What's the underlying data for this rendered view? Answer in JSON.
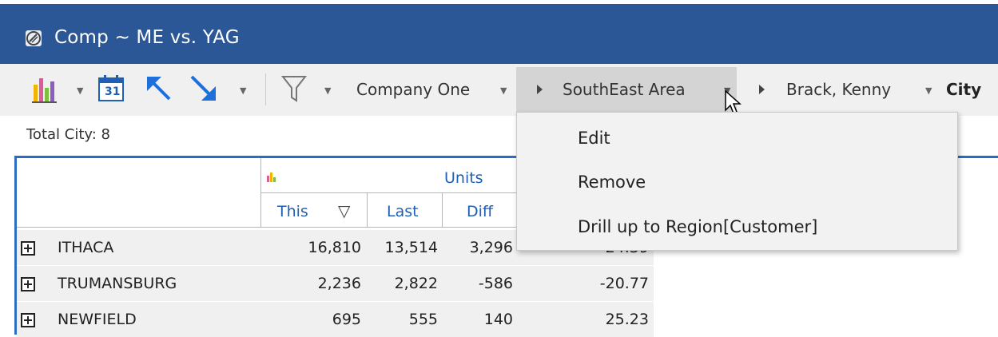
{
  "window": {
    "title": "Comp ~ ME vs. YAG"
  },
  "toolbar": {
    "calendar_day": "31",
    "breadcrumbs": [
      {
        "label": "Company One"
      },
      {
        "label": "SouthEast Area"
      },
      {
        "label": "Brack, Kenny"
      }
    ],
    "level_label": "City"
  },
  "summary": {
    "total": "Total City: 8"
  },
  "grid": {
    "group_header": "Units",
    "columns": [
      "This",
      "Last",
      "Diff"
    ],
    "sort_indicator": "▽",
    "rows": [
      {
        "name": "ITHACA",
        "this": "16,810",
        "last": "13,514",
        "diff": "3,296",
        "pct": "24.39"
      },
      {
        "name": "TRUMANSBURG",
        "this": "2,236",
        "last": "2,822",
        "diff": "-586",
        "pct": "-20.77"
      },
      {
        "name": "NEWFIELD",
        "this": "695",
        "last": "555",
        "diff": "140",
        "pct": "25.23"
      }
    ]
  },
  "context_menu": {
    "items": [
      {
        "label": "Edit"
      },
      {
        "label": "Remove"
      },
      {
        "label": "Drill up to Region[Customer]"
      }
    ]
  },
  "colors": {
    "titlebar": "#2b5797",
    "accent_blue": "#1f5fb4",
    "arrow_blue": "#1e6fd9"
  }
}
